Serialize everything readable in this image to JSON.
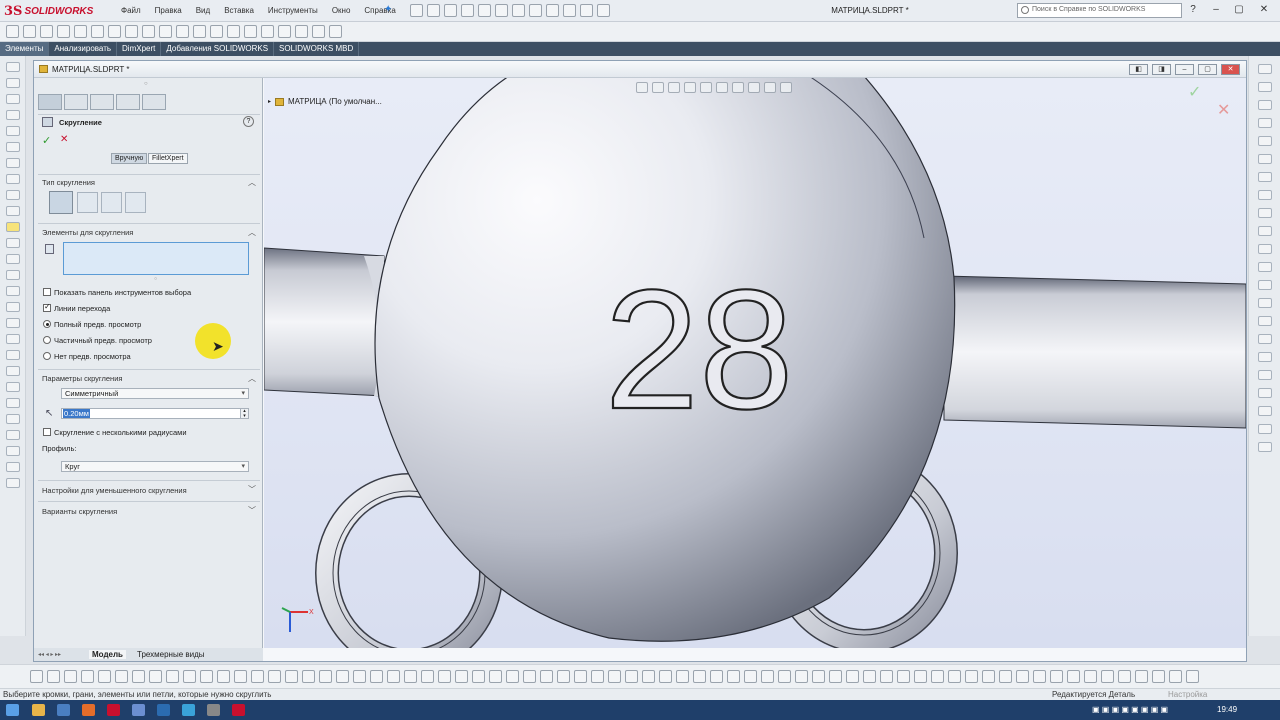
{
  "app": {
    "brand": "SOLIDWORKS",
    "menu": [
      "Файл",
      "Правка",
      "Вид",
      "Вставка",
      "Инструменты",
      "Окно",
      "Справка"
    ],
    "doc_title": "МАТРИЦА.SLDPRT *",
    "help_search_placeholder": "Поиск в Справке по SOLIDWORKS",
    "window_controls": [
      "?",
      "–",
      "▢",
      "✕"
    ]
  },
  "command_tabs": [
    "Элементы",
    "Анализировать",
    "DimXpert",
    "Добавления SOLIDWORKS",
    "SOLIDWORKS MBD"
  ],
  "document_window": {
    "title": "МАТРИЦА.SLDPRT *"
  },
  "feature_tree": {
    "root_label": "МАТРИЦА  (По умолчан..."
  },
  "property_manager": {
    "title": "Скругление",
    "help_icon": "?",
    "ok_icon": "✓",
    "cancel_icon": "✕",
    "mode_buttons": [
      "Вручную",
      "FilletXpert"
    ],
    "section_fillet_type": "Тип скругления",
    "section_items": "Элементы для скругления",
    "show_selection_toolbar": "Показать панель инструментов выбора",
    "tangent_propagation": "Линии перехода",
    "preview_full": "Полный предв. просмотр",
    "preview_partial": "Частичный предв. просмотр",
    "preview_none": "Нет предв. просмотра",
    "section_parameters": "Параметры скругления",
    "parameter_type": "Симметричный",
    "radius_value": "0.20мм",
    "multi_radius": "Скругление с несколькими радиусами",
    "profile_label": "Профиль:",
    "profile_value": "Круг",
    "section_setback": "Настройки для уменьшенного скругления",
    "section_options": "Варианты скругления",
    "checkbox_states": {
      "show_selection_toolbar": false,
      "tangent_propagation": true,
      "multi_radius": false
    },
    "preview_selected": "full"
  },
  "model_tabs": [
    "Модель",
    "Трехмерные виды"
  ],
  "viewport": {
    "engraved_text": "28",
    "triad_x": "X"
  },
  "status": {
    "prompt": "Выберите кромки, грани, элементы или петли, которые нужно скруглить",
    "editing": "Редактируется Деталь",
    "custom": "Настройка"
  },
  "taskbar": {
    "clock": "19:49"
  }
}
